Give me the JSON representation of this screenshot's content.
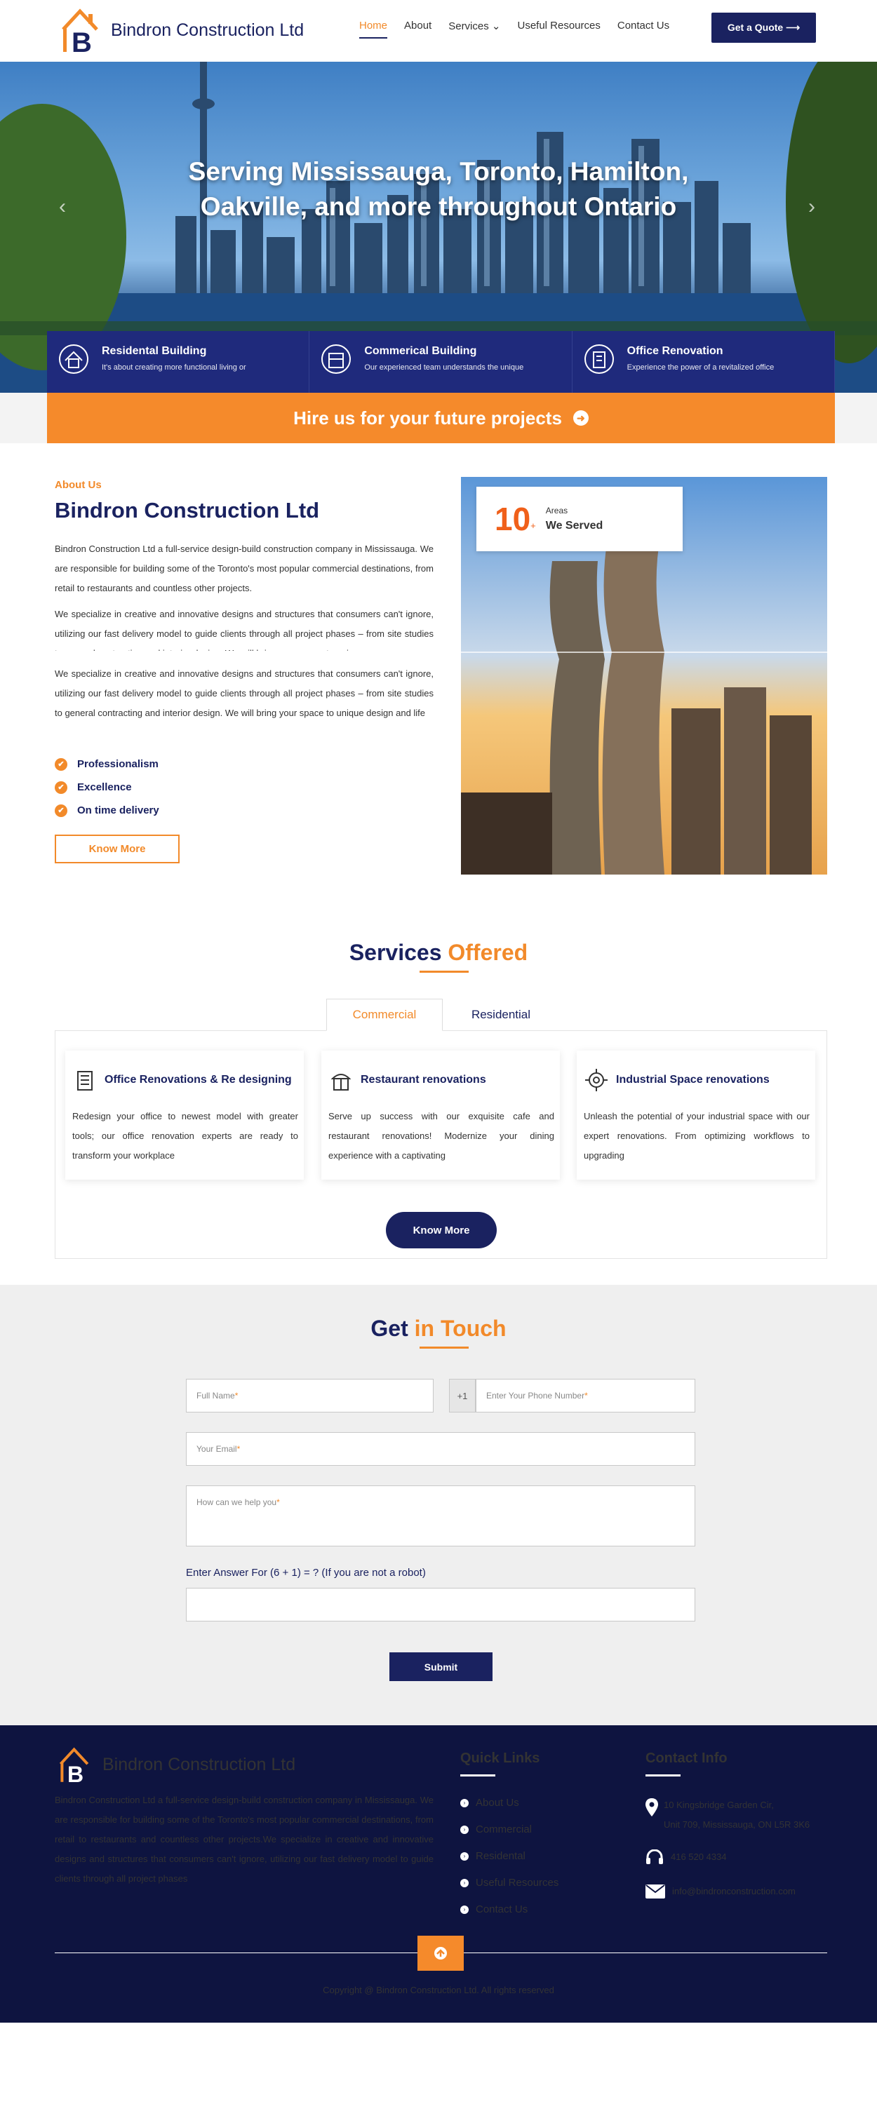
{
  "header": {
    "brand": "Bindron Construction Ltd",
    "nav": [
      {
        "label": "Home",
        "active": true
      },
      {
        "label": "About"
      },
      {
        "label": "Services ⌄"
      },
      {
        "label": "Useful Resources"
      },
      {
        "label": "Contact Us"
      }
    ],
    "quote_button": "Get a Quote ⟶"
  },
  "hero": {
    "title_line1": "Serving Mississauga, Toronto, Hamilton,",
    "title_line2": "Oakville, and more throughout Ontario",
    "prev": "‹",
    "next": "›",
    "cards": [
      {
        "title": "Residental Building",
        "desc": "It's about creating more functional living or"
      },
      {
        "title": "Commerical Building",
        "desc": "Our experienced team understands the unique"
      },
      {
        "title": "Office Renovation",
        "desc": "Experience the power of a revitalized office"
      }
    ],
    "hire_label": "Hire us for your future projects"
  },
  "about": {
    "subtitle": "About Us",
    "title": "Bindron Construction Ltd",
    "p1": "Bindron Construction Ltd a full-service design-build construction company in Mississauga. We are responsible for building some of the Toronto's most popular commercial destinations, from retail to restaurants and countless other projects.",
    "p2": "We specialize in creative and innovative designs and structures that consumers can't ignore, utilizing our fast delivery model to guide clients through all project phases – from site studies to general contracting and interior design. We will bring your space to unique",
    "p3": "We specialize in creative and innovative designs and structures that consumers can't ignore, utilizing our fast delivery model to guide clients through all project phases – from site studies to general contracting and interior design. We will bring your space to unique design and life",
    "checks": [
      "Professionalism",
      "Excellence",
      "On time delivery"
    ],
    "know_more": "Know More",
    "stat_number": "10",
    "stat_plus": "+",
    "stat_label1": "Areas",
    "stat_label2": "We Served"
  },
  "services": {
    "title_a": "Services",
    "title_b": "Offered",
    "tabs": [
      {
        "label": "Commercial",
        "active": true
      },
      {
        "label": "Residential"
      }
    ],
    "items": [
      {
        "title": "Office Renovations & Re designing",
        "desc": "Redesign your office to newest model with greater tools; our office renovation experts are ready to transform your workplace"
      },
      {
        "title": "Restaurant renovations",
        "desc": "Serve up success with our exquisite cafe and restaurant renovations! Modernize your dining experience with a captivating"
      },
      {
        "title": "Industrial Space renovations",
        "desc": "Unleash the potential of your industrial space with our expert renovations. From optimizing workflows to upgrading"
      }
    ],
    "button": "Know More"
  },
  "contact": {
    "title_a": "Get",
    "title_b": "in Touch",
    "full_name": "Full Name",
    "code": "+1",
    "phone": "Enter Your Phone Number ",
    "email": "Your Email",
    "message": "How can we help you ",
    "req": "*",
    "robot": "Enter Answer For (6 + 1) = ? (If you are not a robot)",
    "submit": "Submit"
  },
  "footer": {
    "brand": "Bindron Construction Ltd",
    "text": "Bindron Construction Ltd a full-service design-build construction company in Mississauga. We are responsible for building some of the Toronto's most popular commercial destinations, from retail to restaurants and countless other projects.We specialize in creative and innovative designs and structures that consumers can't ignore, utilizing our fast delivery model to guide clients through all project phases",
    "quick_links_title": "Quick Links",
    "links": [
      "About Us",
      "Commercial",
      "Residental",
      "Useful Resources",
      "Contact Us"
    ],
    "contact_title": "Contact Info",
    "address1": "10 Kingsbridge Garden Cir,",
    "address2": "Unit 709, Mississauga, ON L5R 3K6",
    "phone": "416 520 4334",
    "email": "info@bindronconstruction.com",
    "copyright": "Copyright @ Bindron Construction Ltd. All rights reserved"
  },
  "colors": {
    "navy": "#1a2260",
    "orange": "#f28a2a",
    "footer": "#0e1440"
  }
}
